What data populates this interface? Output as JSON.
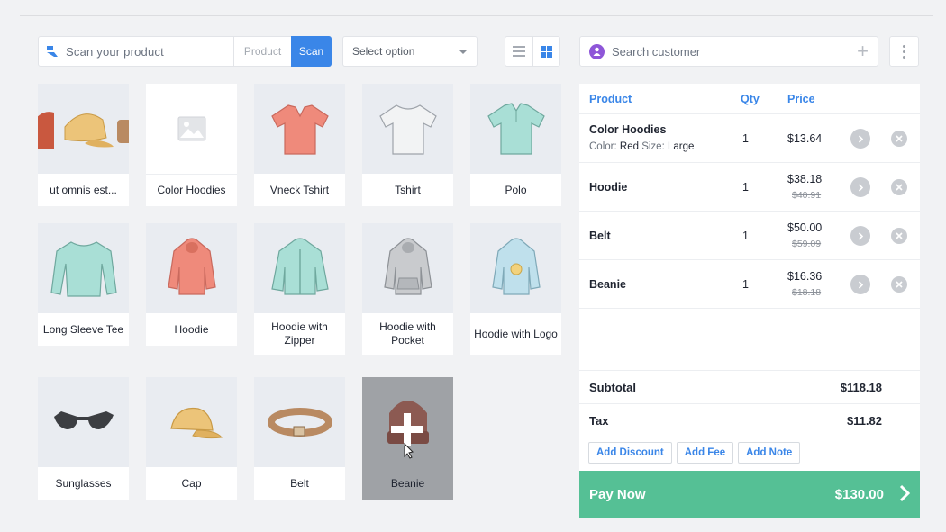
{
  "toolbar": {
    "scan_placeholder": "Scan your product",
    "product_toggle": "Product",
    "scan_button": "Scan",
    "select_option": "Select option",
    "view_modes": [
      "list-view-icon",
      "grid-view-icon"
    ]
  },
  "products": [
    {
      "label": "ut omnis est...",
      "icon": "accessories-collage-icon"
    },
    {
      "label": "Color Hoodies",
      "icon": "image-placeholder-icon"
    },
    {
      "label": "Vneck Tshirt",
      "icon": "vneck-tshirt-icon"
    },
    {
      "label": "Tshirt",
      "icon": "tshirt-icon"
    },
    {
      "label": "Polo",
      "icon": "polo-shirt-icon"
    },
    {
      "label": "Long Sleeve Tee",
      "icon": "long-sleeve-tee-icon"
    },
    {
      "label": "Hoodie",
      "icon": "hoodie-icon"
    },
    {
      "label": "Hoodie with Zipper",
      "icon": "zip-hoodie-icon"
    },
    {
      "label": "Hoodie with Pocket",
      "icon": "pocket-hoodie-icon"
    },
    {
      "label": "Hoodie with Logo",
      "icon": "logo-hoodie-icon"
    },
    {
      "label": "Sunglasses",
      "icon": "sunglasses-icon"
    },
    {
      "label": "Cap",
      "icon": "cap-icon"
    },
    {
      "label": "Belt",
      "icon": "belt-icon"
    },
    {
      "label": "Beanie",
      "icon": "beanie-icon"
    }
  ],
  "customer": {
    "placeholder": "Search customer"
  },
  "cart": {
    "headers": {
      "product": "Product",
      "qty": "Qty",
      "price": "Price"
    },
    "items": [
      {
        "name": "Color Hoodies",
        "meta_color_key": "Color:",
        "meta_color": "Red",
        "meta_size_key": "Size:",
        "meta_size": "Large",
        "qty": "1",
        "price": "$13.64",
        "old_price": ""
      },
      {
        "name": "Hoodie",
        "qty": "1",
        "price": "$38.18",
        "old_price": "$40.91"
      },
      {
        "name": "Belt",
        "qty": "1",
        "price": "$50.00",
        "old_price": "$59.09"
      },
      {
        "name": "Beanie",
        "qty": "1",
        "price": "$16.36",
        "old_price": "$18.18"
      }
    ],
    "subtotal_label": "Subtotal",
    "subtotal": "$118.18",
    "tax_label": "Tax",
    "tax": "$11.82",
    "actions": [
      "Add Discount",
      "Add Fee",
      "Add Note"
    ],
    "pay_label": "Pay Now",
    "total": "$130.00"
  },
  "colors": {
    "accent": "#3a86e8",
    "pay": "#55c095",
    "customer_icon": "#8e56d8"
  }
}
